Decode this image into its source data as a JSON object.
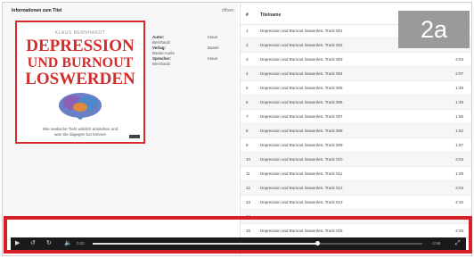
{
  "info": {
    "title": "Informationen zum Titel",
    "close_label": "öffnen",
    "meta": [
      {
        "key": "Autor:",
        "value": "Klaus"
      },
      {
        "sub": "Bernhardt"
      },
      {
        "key": "Verlag:",
        "value": "Bastei"
      },
      {
        "sub": "Bastei Audio"
      },
      {
        "key": "Sprecher:",
        "value": "Klaus"
      },
      {
        "sub": "Bernhardt"
      }
    ]
  },
  "cover": {
    "author": "KLAUS BERNHARDT",
    "line1": "DEPRESSION",
    "line2": "UND BURNOUT",
    "line3": "LOSWERDEN",
    "tagline1": "Wie seelische Tiefs wirklich entstehen und",
    "tagline2": "was Sie dagegen tun können"
  },
  "tracks": {
    "header_num": "#",
    "header_title": "Titelname",
    "rows": [
      {
        "num": "1",
        "title": "Depression und Burnout loswerden, Track 001",
        "duration": ""
      },
      {
        "num": "2",
        "title": "Depression und Burnout loswerden, Track 002",
        "duration": ""
      },
      {
        "num": "3",
        "title": "Depression und Burnout loswerden, Track 003",
        "duration": "2:03"
      },
      {
        "num": "4",
        "title": "Depression und Burnout loswerden, Track 004",
        "duration": "2:07"
      },
      {
        "num": "5",
        "title": "Depression und Burnout loswerden, Track 005",
        "duration": "1:48"
      },
      {
        "num": "6",
        "title": "Depression und Burnout loswerden, Track 006",
        "duration": "1:48"
      },
      {
        "num": "7",
        "title": "Depression und Burnout loswerden, Track 007",
        "duration": "1:55"
      },
      {
        "num": "8",
        "title": "Depression und Burnout loswerden, Track 008",
        "duration": "1:52"
      },
      {
        "num": "9",
        "title": "Depression und Burnout loswerden, Track 009",
        "duration": "1:57"
      },
      {
        "num": "10",
        "title": "Depression und Burnout loswerden, Track 010",
        "duration": "2:03"
      },
      {
        "num": "11",
        "title": "Depression und Burnout loswerden, Track 011",
        "duration": "1:29"
      },
      {
        "num": "12",
        "title": "Depression und Burnout loswerden, Track 012",
        "duration": "2:03"
      },
      {
        "num": "13",
        "title": "Depression und Burnout loswerden, Track 013",
        "duration": "2:10"
      },
      {
        "num": "14",
        "title": "",
        "duration": ""
      },
      {
        "num": "15",
        "title": "Depression und Burnout loswerden, Track 015",
        "duration": "2:25"
      }
    ]
  },
  "badge": {
    "label": "2a",
    "color": "#9a9a9a"
  },
  "player": {
    "highlight_color": "#d61f26",
    "elapsed": "0:22",
    "remaining": "-1:59",
    "progress": 0.68,
    "play_icon": "play-icon",
    "rewind_icon": "rewind-icon",
    "forward_icon": "forward-icon",
    "volume_icon": "volume-icon",
    "fullscreen_icon": "fullscreen-icon"
  }
}
